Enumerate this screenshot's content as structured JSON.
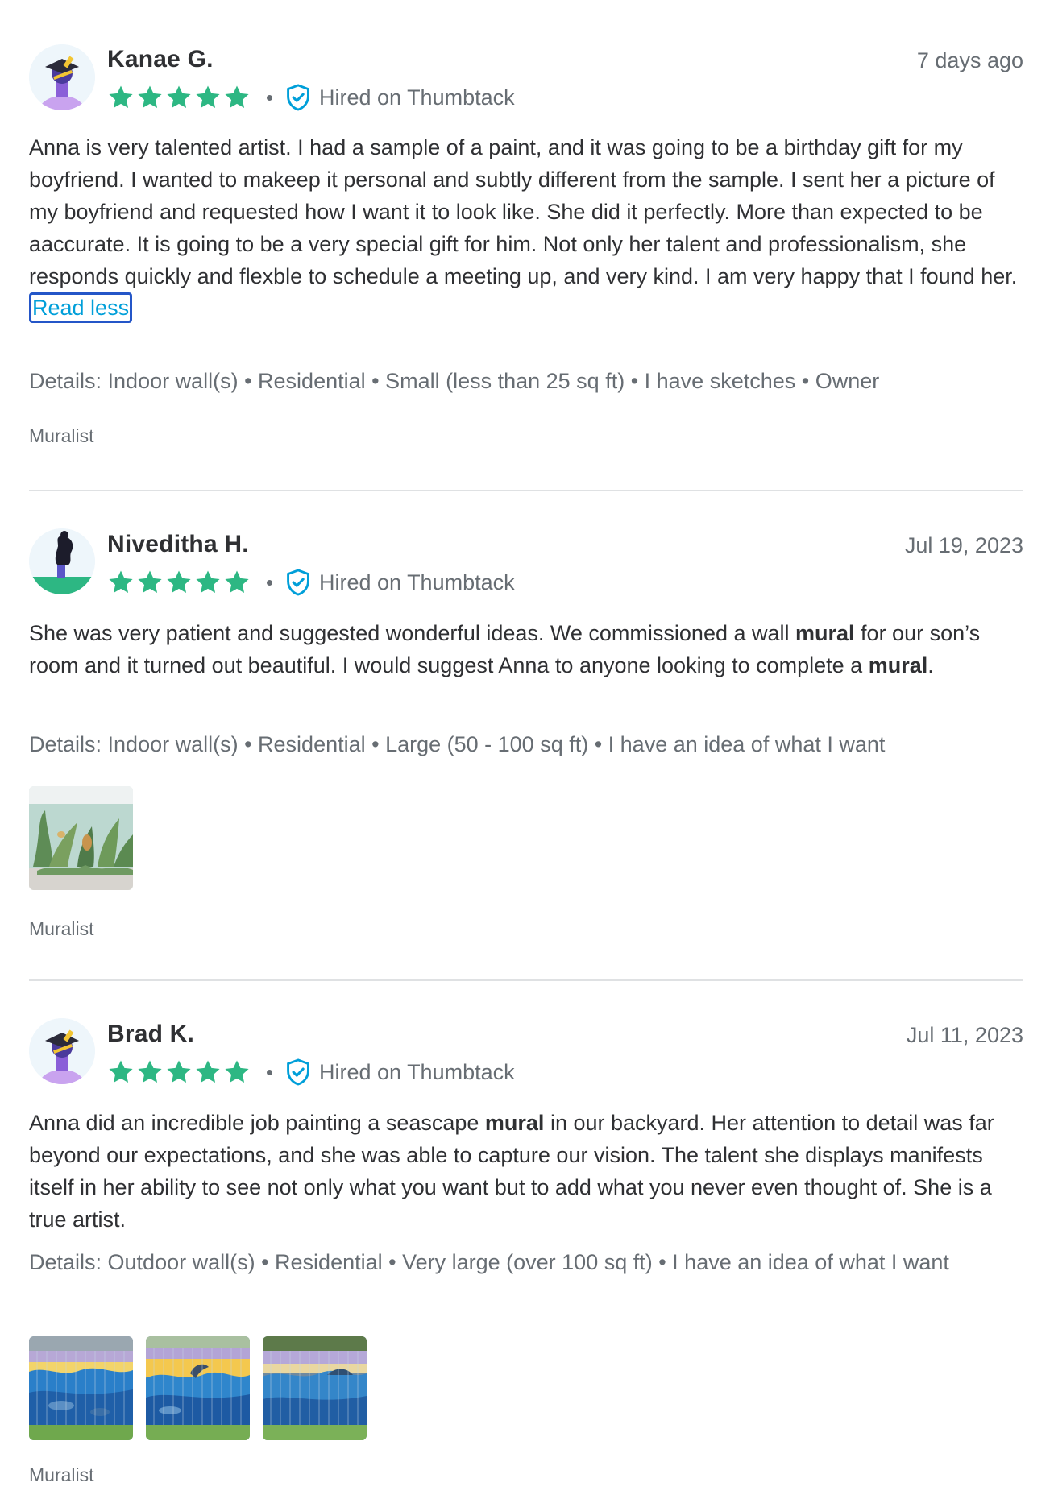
{
  "reviews": [
    {
      "name": "Kanae G.",
      "date": "7 days ago",
      "rating": 5,
      "hired_label": "Hired on Thumbtack",
      "text_html": "Anna is very talented artist. I had a sample of a paint, and it was going to be a birthday gift for my boyfriend. I wanted to makeep it personal and subtly different from the sample. I sent her a picture of my boyfriend and requested how I want it to look like. She did it perfectly. More than expected to be aaccurate. It is going to be a very special gift for him. Not only her talent and professionalism, she responds quickly and flexble to schedule a meeting up, and very kind. I am very happy that I found her.",
      "read_less": "Read less",
      "details": "Details: Indoor wall(s) • Residential • Small (less than 25 sq ft) • I have sketches • Owner",
      "category": "Muralist",
      "avatar_icon": "avatar-graduate-icon"
    },
    {
      "name": "Niveditha H.",
      "date": "Jul 19, 2023",
      "rating": 5,
      "hired_label": "Hired on Thumbtack",
      "text_parts": [
        "She was very patient and suggested wonderful ideas. We commissioned a wall ",
        "mural",
        " for our son’s room and it turned out beautiful. I would suggest Anna to anyone looking to complete a ",
        "mural",
        "."
      ],
      "details": "Details: Indoor wall(s) • Residential • Large (50 - 100 sq ft) • I have an idea of what I want",
      "category": "Muralist",
      "avatar_icon": "avatar-profile-icon",
      "photos": [
        "jungle-mural-photo"
      ]
    },
    {
      "name": "Brad K.",
      "date": "Jul 11, 2023",
      "rating": 5,
      "hired_label": "Hired on Thumbtack",
      "text_parts": [
        "Anna did an incredible job painting a seascape ",
        "mural",
        " in our backyard. Her attention to detail was far beyond our expectations, and she was able to capture our vision. The talent she displays manifests itself in her ability to see not only what you want but to add what you never even thought of. She is a true artist."
      ],
      "details": "Details: Outdoor wall(s) • Residential • Very large (over 100 sq ft) • I have an idea of what I want",
      "category": "Muralist",
      "avatar_icon": "avatar-graduate-icon",
      "photos": [
        "seascape-fence-photo-1",
        "seascape-fence-photo-2",
        "seascape-fence-photo-3"
      ]
    }
  ],
  "colors": {
    "star": "#2db783",
    "text": "#2f3033",
    "muted": "#676d73",
    "link": "#009fd9",
    "shield": "#009fd9",
    "divider": "#dfe1e3"
  }
}
